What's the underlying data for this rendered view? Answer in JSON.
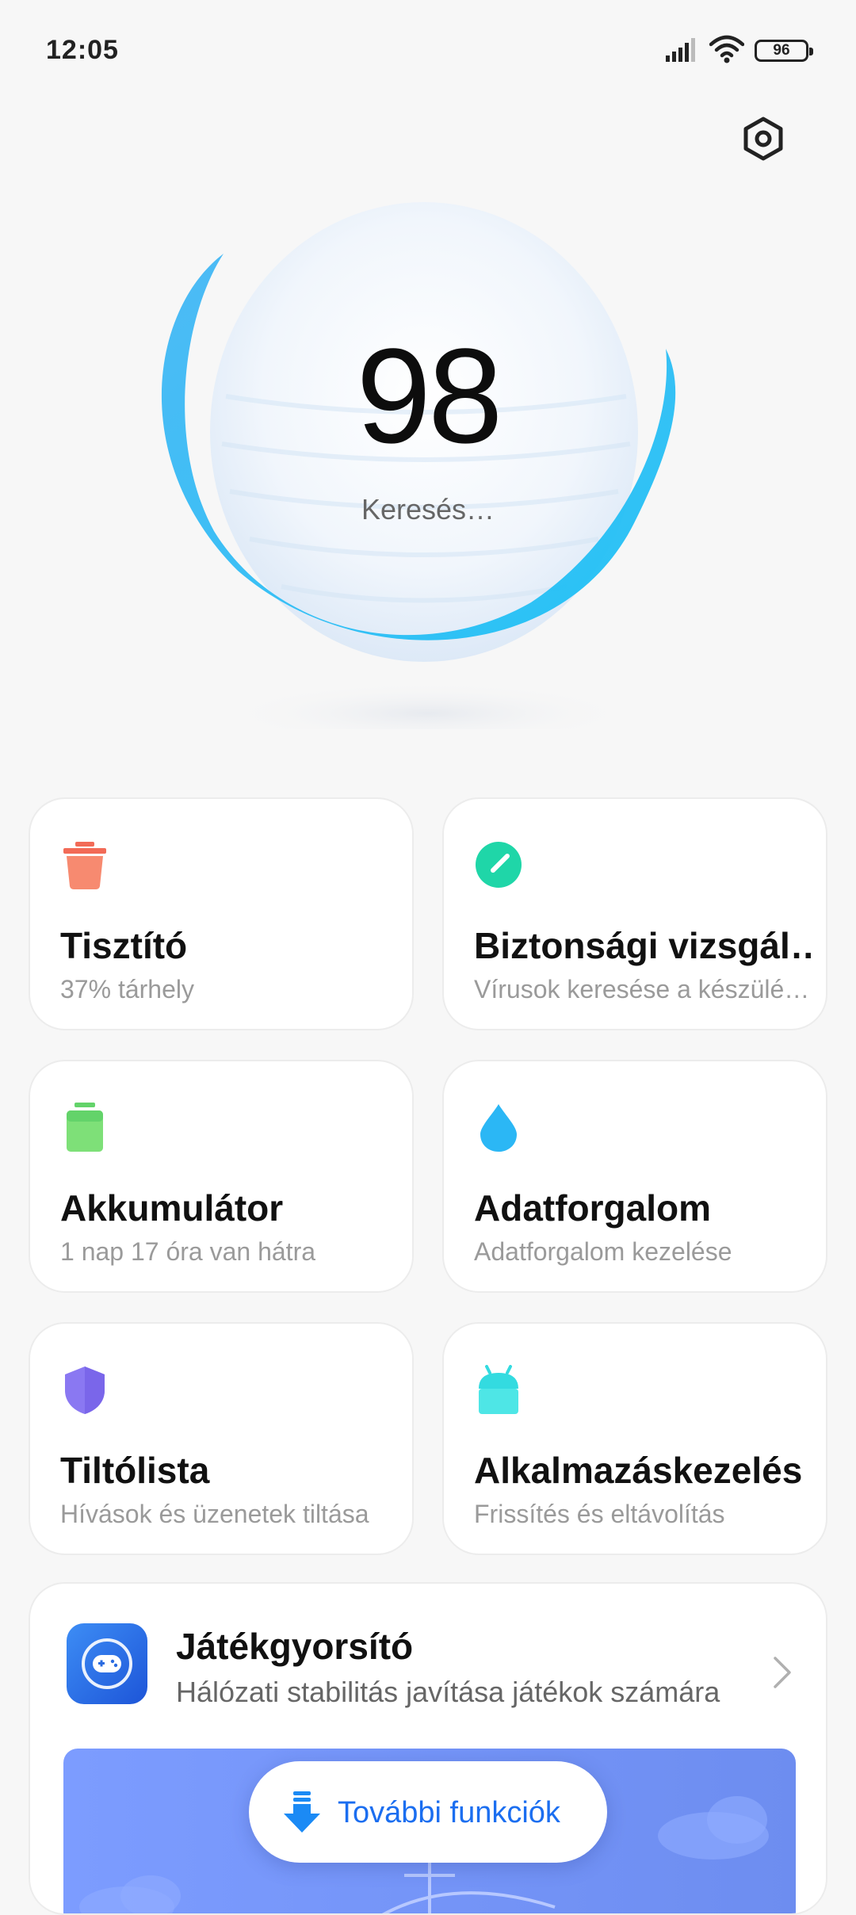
{
  "status_bar": {
    "time": "12:05",
    "battery": "96"
  },
  "score": {
    "value": "98",
    "status": "Keresés…"
  },
  "cards": [
    {
      "title": "Tisztító",
      "subtitle": "37% tárhely",
      "icon": "trash-icon",
      "color": "#f26b57"
    },
    {
      "title": "Biztonsági vizsgál…",
      "subtitle": "Vírusok keresése a készülé…",
      "icon": "security-scan-icon",
      "color": "#1fd6a8"
    },
    {
      "title": "Akkumulátor",
      "subtitle": "1 nap 17 óra  van hátra",
      "icon": "battery-icon",
      "color": "#63d36a"
    },
    {
      "title": "Adatforgalom",
      "subtitle": "Adatforgalom kezelése",
      "icon": "water-drop-icon",
      "color": "#2bb7f5"
    },
    {
      "title": "Tiltólista",
      "subtitle": "Hívások és üzenetek tiltása",
      "icon": "shield-icon",
      "color": "#8a78f2"
    },
    {
      "title": "Alkalmazáskezelés",
      "subtitle": "Frissítés és eltávolítás",
      "icon": "android-icon",
      "color": "#33dbe0"
    }
  ],
  "game_booster": {
    "title": "Játékgyorsító",
    "subtitle": "Hálózati stabilitás javítása játékok számára",
    "icon": "gamepad-icon"
  },
  "more_button": {
    "label": "További funkciók",
    "icon": "download-arrow-icon"
  }
}
